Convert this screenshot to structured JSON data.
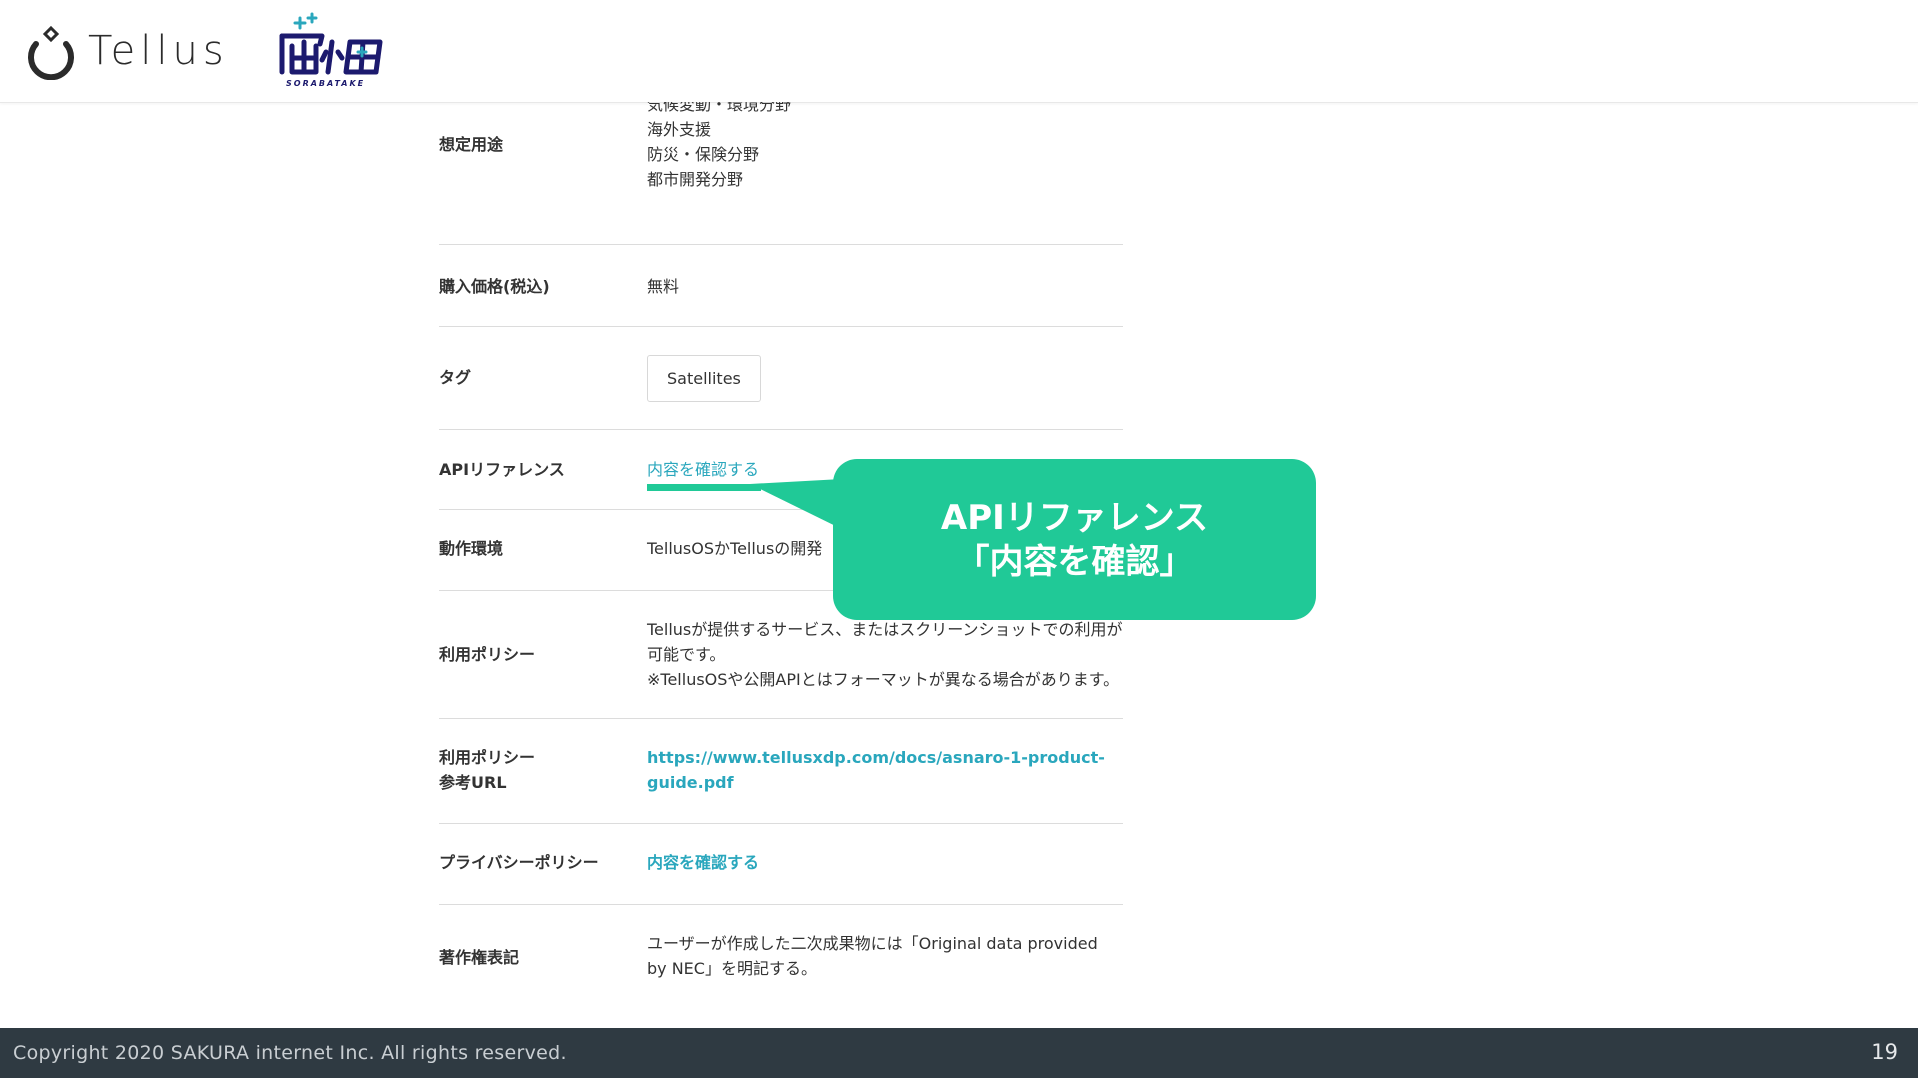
{
  "header": {
    "brand_name": "Tellus",
    "partner_logo_sub": "SORABATAKE"
  },
  "rows": [
    {
      "label": "想定用途",
      "values": [
        "気候変動・環境分野",
        "海外支援",
        "防災・保険分野",
        "都市開発分野"
      ]
    },
    {
      "label": "購入価格(税込)",
      "value": "無料"
    },
    {
      "label": "タグ",
      "tag": "Satellites"
    },
    {
      "label": "APIリファレンス",
      "link": "内容を確認する"
    },
    {
      "label": "動作環境",
      "value": "TellusOSかTellusの開発"
    },
    {
      "label": "利用ポリシー",
      "values": [
        "Tellusが提供するサービス、またはスクリーンショットでの利用が",
        "可能です。",
        "※TellusOSや公開APIとはフォーマットが異なる場合があります。"
      ]
    },
    {
      "label_lines": [
        "利用ポリシー",
        "参考URL"
      ],
      "link_lines": [
        "https://www.tellusxdp.com/docs/asnaro-1-product-",
        "guide.pdf"
      ]
    },
    {
      "label": "プライバシーポリシー",
      "link": "内容を確認する"
    },
    {
      "label": "著作権表記",
      "values": [
        "ユーザーが作成した二次成果物には「Original data provided",
        "by NEC」を明記する。"
      ]
    }
  ],
  "callout": {
    "line1": "APIリファレンス",
    "line2": "「内容を確認」",
    "color": "#20c997"
  },
  "footer": {
    "copyright": "Copyright 2020 SAKURA internet Inc. All rights reserved.",
    "page_number": "19"
  },
  "colors": {
    "link": "#2aa7bd",
    "accent": "#20c997",
    "footer_bg": "#2f3a42"
  }
}
